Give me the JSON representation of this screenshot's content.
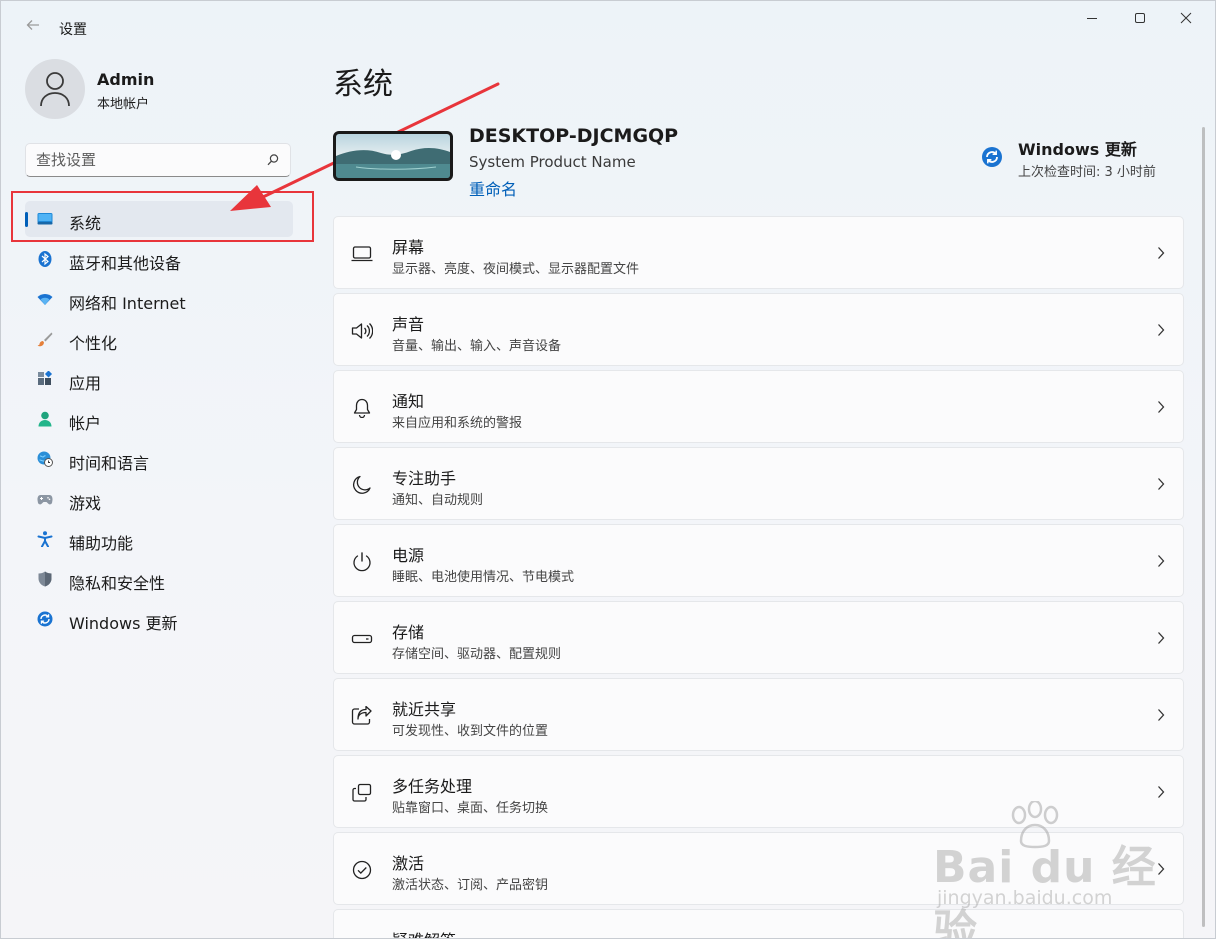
{
  "window": {
    "title": "设置"
  },
  "user": {
    "name": "Admin",
    "account_type": "本地帐户"
  },
  "search": {
    "placeholder": "查找设置"
  },
  "nav": {
    "items": [
      {
        "label": "系统",
        "icon": "monitor-icon",
        "active": true
      },
      {
        "label": "蓝牙和其他设备",
        "icon": "bluetooth-icon"
      },
      {
        "label": "网络和 Internet",
        "icon": "wifi-icon"
      },
      {
        "label": "个性化",
        "icon": "brush-icon"
      },
      {
        "label": "应用",
        "icon": "apps-icon"
      },
      {
        "label": "帐户",
        "icon": "account-icon"
      },
      {
        "label": "时间和语言",
        "icon": "globe-clock-icon"
      },
      {
        "label": "游戏",
        "icon": "gamepad-icon"
      },
      {
        "label": "辅助功能",
        "icon": "accessibility-icon"
      },
      {
        "label": "隐私和安全性",
        "icon": "shield-icon"
      },
      {
        "label": "Windows 更新",
        "icon": "update-icon"
      }
    ]
  },
  "main": {
    "title": "系统",
    "device": {
      "name": "DESKTOP-DJCMGQP",
      "model": "System Product Name",
      "rename_label": "重命名"
    },
    "windows_update": {
      "title": "Windows 更新",
      "last_check": "上次检查时间: 3 小时前"
    },
    "settings": [
      {
        "title": "屏幕",
        "subtitle": "显示器、亮度、夜间模式、显示器配置文件",
        "icon": "display-icon"
      },
      {
        "title": "声音",
        "subtitle": "音量、输出、输入、声音设备",
        "icon": "speaker-icon"
      },
      {
        "title": "通知",
        "subtitle": "来自应用和系统的警报",
        "icon": "bell-icon"
      },
      {
        "title": "专注助手",
        "subtitle": "通知、自动规则",
        "icon": "moon-icon"
      },
      {
        "title": "电源",
        "subtitle": "睡眠、电池使用情况、节电模式",
        "icon": "power-icon"
      },
      {
        "title": "存储",
        "subtitle": "存储空间、驱动器、配置规则",
        "icon": "storage-icon"
      },
      {
        "title": "就近共享",
        "subtitle": "可发现性、收到文件的位置",
        "icon": "share-icon"
      },
      {
        "title": "多任务处理",
        "subtitle": "贴靠窗口、桌面、任务切换",
        "icon": "multitask-icon"
      },
      {
        "title": "激活",
        "subtitle": "激活状态、订阅、产品密钥",
        "icon": "check-circle-icon"
      },
      {
        "title": "疑难解答",
        "subtitle": "",
        "icon": "wrench-icon"
      }
    ]
  },
  "watermark": {
    "brand": "Bai du 经验",
    "url": "jingyan.baidu.com"
  },
  "colors": {
    "accent": "#005fb8",
    "highlight": "#e8353b"
  }
}
